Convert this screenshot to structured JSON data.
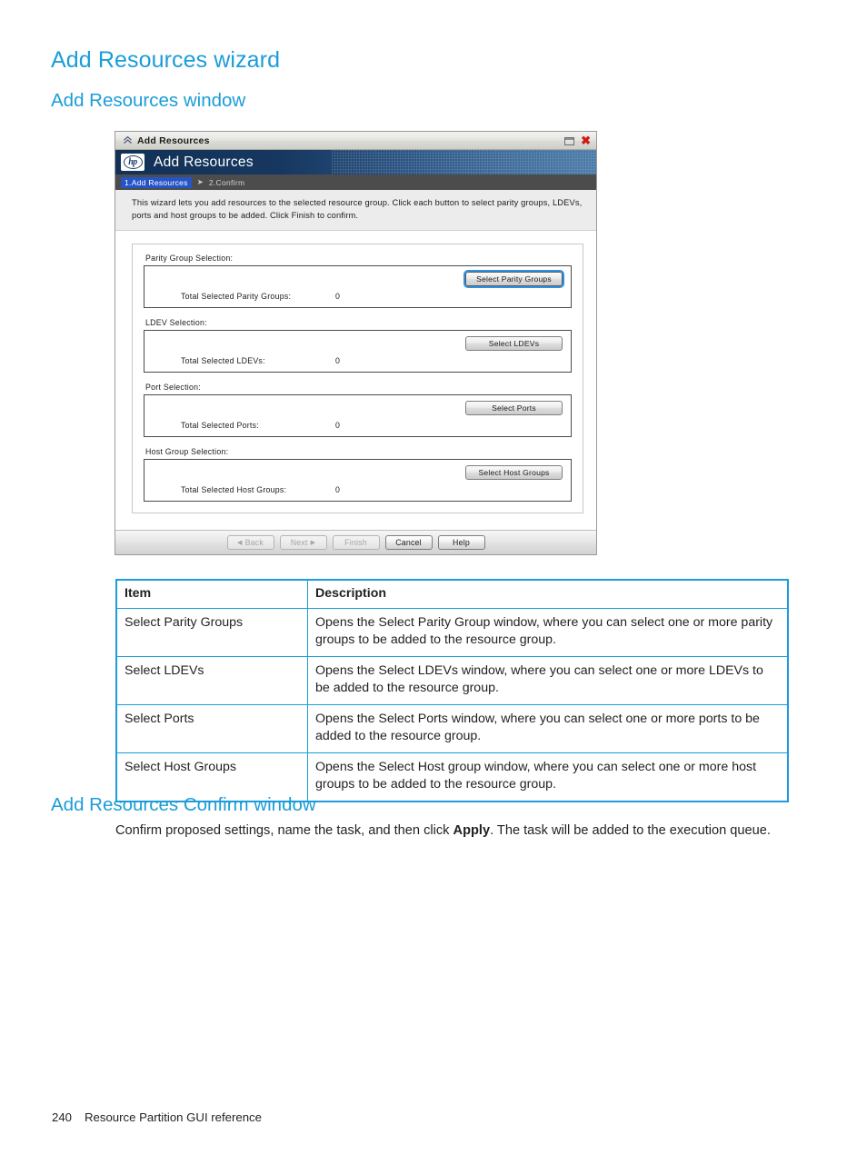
{
  "document": {
    "heading": "Add Resources wizard",
    "section_heading": "Add Resources window",
    "confirm_heading": "Add Resources Confirm window",
    "confirm_text_before": "Confirm proposed settings, name the task, and then click ",
    "confirm_emphasis": "Apply",
    "confirm_text_after": ". The task will be added to the execution queue.",
    "page_number": "240",
    "running_footer": "Resource Partition GUI reference"
  },
  "dialog": {
    "titlebar": {
      "title": "Add Resources",
      "collapse_icon": "double-chevron-up-icon",
      "maximize_icon": "maximize-icon",
      "close_icon": "close-icon"
    },
    "banner": {
      "logo_text": "hp",
      "title": "Add Resources"
    },
    "steps": {
      "active": "1.Add Resources",
      "separator": "➤",
      "inactive": "2.Confirm"
    },
    "instruction": "This wizard lets you add resources to the selected resource group. Click each button to select parity groups, LDEVs, ports and host groups to be added. Click Finish to confirm.",
    "sections": [
      {
        "label": "Parity Group Selection:",
        "button": "Select Parity Groups",
        "focused": true,
        "total_label": "Total Selected Parity Groups:",
        "total_value": "0"
      },
      {
        "label": "LDEV Selection:",
        "button": "Select LDEVs",
        "focused": false,
        "total_label": "Total Selected LDEVs:",
        "total_value": "0"
      },
      {
        "label": "Port Selection:",
        "button": "Select Ports",
        "focused": false,
        "total_label": "Total Selected Ports:",
        "total_value": "0"
      },
      {
        "label": "Host Group Selection:",
        "button": "Select Host Groups",
        "focused": false,
        "total_label": "Total Selected Host Groups:",
        "total_value": "0"
      }
    ],
    "footer_buttons": [
      {
        "label": "Back",
        "enabled": false,
        "arrow": "left"
      },
      {
        "label": "Next",
        "enabled": false,
        "arrow": "right"
      },
      {
        "label": "Finish",
        "enabled": false,
        "arrow": "none"
      },
      {
        "label": "Cancel",
        "enabled": true,
        "arrow": "none"
      },
      {
        "label": "Help",
        "enabled": true,
        "arrow": "none"
      }
    ]
  },
  "reference_table": {
    "headers": [
      "Item",
      "Description"
    ],
    "rows": [
      {
        "item": "Select Parity Groups",
        "description": "Opens the Select Parity Group window, where you can select one or more parity groups to be added to the resource group."
      },
      {
        "item": "Select LDEVs",
        "description": "Opens the Select LDEVs window, where you can select one or more LDEVs to be added to the resource group."
      },
      {
        "item": "Select Ports",
        "description": "Opens the Select Ports window, where you can select one or more ports to be added to the resource group."
      },
      {
        "item": "Select Host Groups",
        "description": "Opens the Select Host group window, where you can select one or more host groups to be added to the resource group."
      }
    ]
  },
  "colors": {
    "heading_blue": "#1b9dd9",
    "table_border_blue": "#1b9dd9",
    "banner_navy": "#123157",
    "step_active_blue": "#2554c7",
    "close_red": "#d11a1a"
  }
}
